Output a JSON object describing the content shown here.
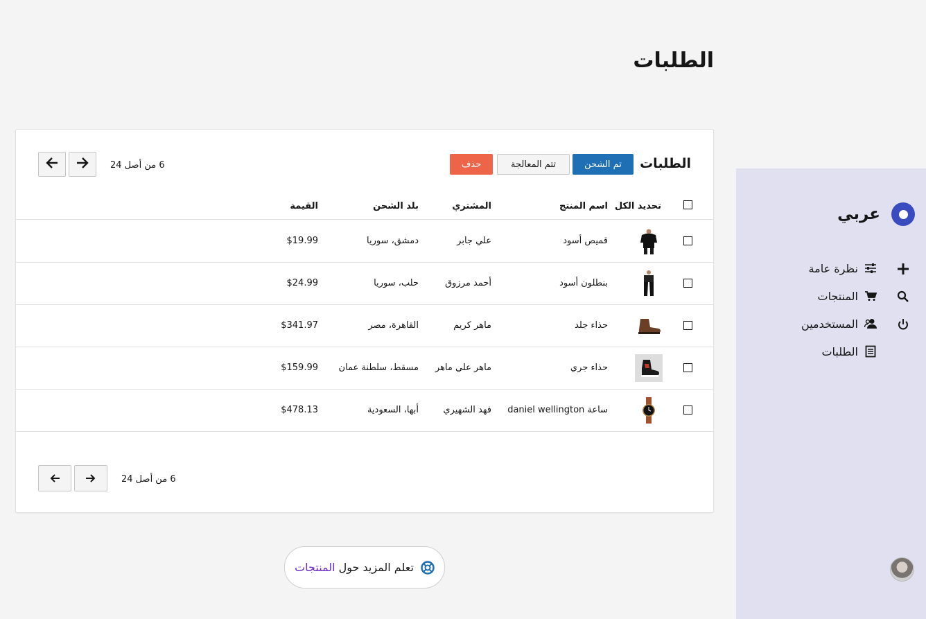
{
  "page": {
    "title": "الطلبات"
  },
  "sidebar": {
    "brand": "عربي",
    "rail_icons": [
      "plus-icon",
      "search-icon",
      "power-icon"
    ],
    "items": [
      {
        "label": "نظرة عامة",
        "icon": "sliders-icon"
      },
      {
        "label": "المنتجات",
        "icon": "cart-icon"
      },
      {
        "label": "المستخدمين",
        "icon": "users-icon"
      },
      {
        "label": "الطلبات",
        "icon": "document-icon"
      }
    ]
  },
  "orders": {
    "title": "الطلبات",
    "actions": {
      "shipped": "تم الشحن",
      "processing": "تتم المعالجة",
      "delete": "حذف"
    },
    "pagination_top": "6 من أصل 24",
    "pagination_bottom": "6 من أصل 24",
    "columns": {
      "select_all": "تحديد الكل",
      "product": "اسم المنتج",
      "buyer": "المشتري",
      "country": "بلد الشحن",
      "price": "القيمة"
    },
    "rows": [
      {
        "product": "قميص أسود",
        "buyer": "علي جابر",
        "country": "دمشق، سوريا",
        "price": "$19.99",
        "thumb": "shirt"
      },
      {
        "product": "بنطلون أسود",
        "buyer": "أحمد مرزوق",
        "country": "حلب، سوريا",
        "price": "$24.99",
        "thumb": "pants"
      },
      {
        "product": "حذاء جلد",
        "buyer": "ماهر كريم",
        "country": "القاهرة، مصر",
        "price": "$341.97",
        "thumb": "boot"
      },
      {
        "product": "حذاء جري",
        "buyer": "ماهر علي ماهر",
        "country": "مسقط، سلطنة عمان",
        "price": "$159.99",
        "thumb": "sneaker"
      },
      {
        "product": "ساعة daniel wellington",
        "buyer": "فهد الشهيري",
        "country": "أبها، السعودية",
        "price": "$478.13",
        "thumb": "watch"
      }
    ]
  },
  "learn_more": {
    "prefix": "تعلم المزيد حول",
    "link": "المنتجات"
  },
  "colors": {
    "primary": "#1f6fb5",
    "danger": "#ee6448",
    "sidebar_bg": "#e0e0f0",
    "link": "#6929c4"
  }
}
